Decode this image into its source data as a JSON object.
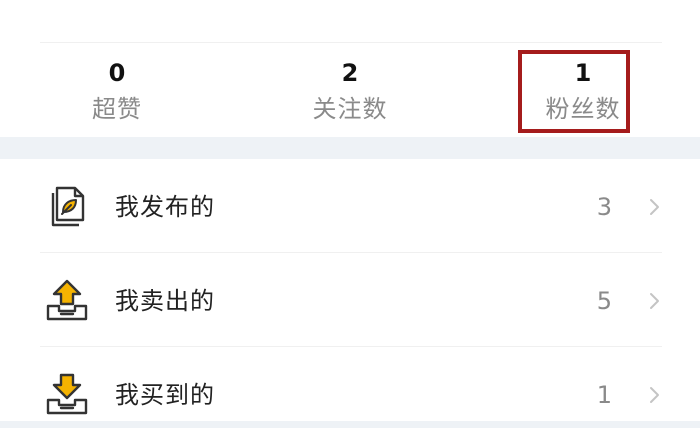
{
  "stats": {
    "likes": {
      "count": "0",
      "label": "超赞"
    },
    "following": {
      "count": "2",
      "label": "关注数"
    },
    "followers": {
      "count": "1",
      "label": "粉丝数"
    }
  },
  "menu": {
    "items": [
      {
        "label": "我发布的",
        "count": "3",
        "icon": "published-document-icon"
      },
      {
        "label": "我卖出的",
        "count": "5",
        "icon": "tray-upload-icon"
      },
      {
        "label": "我买到的",
        "count": "1",
        "icon": "tray-download-icon"
      }
    ]
  },
  "colors": {
    "highlight": "#a51c1c",
    "icon_accent": "#f5b301",
    "icon_stroke": "#333333",
    "band": "#eef2f6"
  }
}
